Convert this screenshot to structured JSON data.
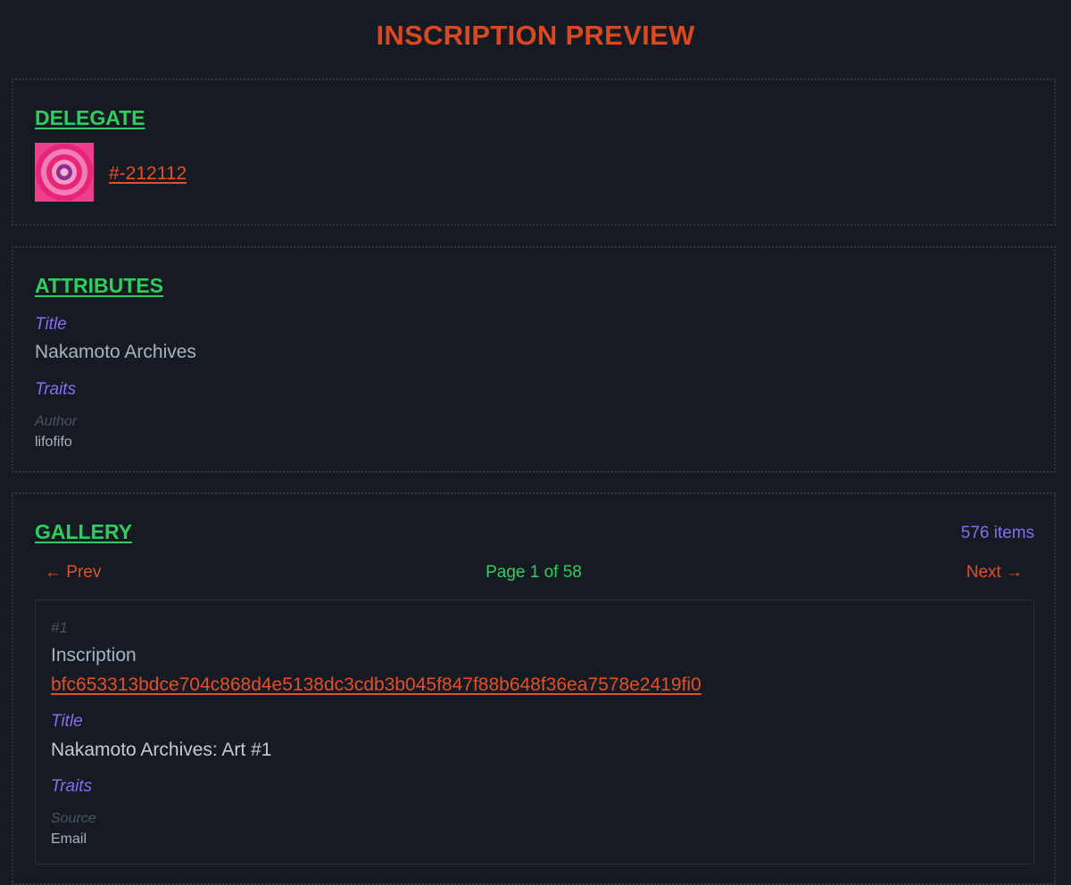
{
  "page_title": "INSCRIPTION PREVIEW",
  "colors": {
    "background": "#161a22",
    "accent_orange": "#e2502a",
    "heading_green": "#2fcd5e",
    "label_purple": "#8a6cf0",
    "text_gray": "#aab2c0",
    "muted": "#4b5263"
  },
  "delegate": {
    "heading": "DELEGATE",
    "thumbnail_icon": "concentric-circles-image",
    "link_text": "#-212112"
  },
  "attributes": {
    "heading": "ATTRIBUTES",
    "title_label": "Title",
    "title_value": "Nakamoto Archives",
    "traits_label": "Traits",
    "trait_key": "Author",
    "trait_value": "lifofifo"
  },
  "gallery": {
    "heading": "GALLERY",
    "count_text": "576 items",
    "prev_label": "← Prev",
    "page_text": "Page 1 of 58",
    "next_label": "Next →",
    "item": {
      "index": "#1",
      "inscription_label": "Inscription",
      "inscription_id": "bfc653313bdce704c868d4e5138dc3cdb3b045f847f88b648f36ea7578e2419fi0",
      "title_label": "Title",
      "title_value": "Nakamoto Archives: Art #1",
      "traits_label": "Traits",
      "trait_key": "Source",
      "trait_value": "Email"
    }
  }
}
